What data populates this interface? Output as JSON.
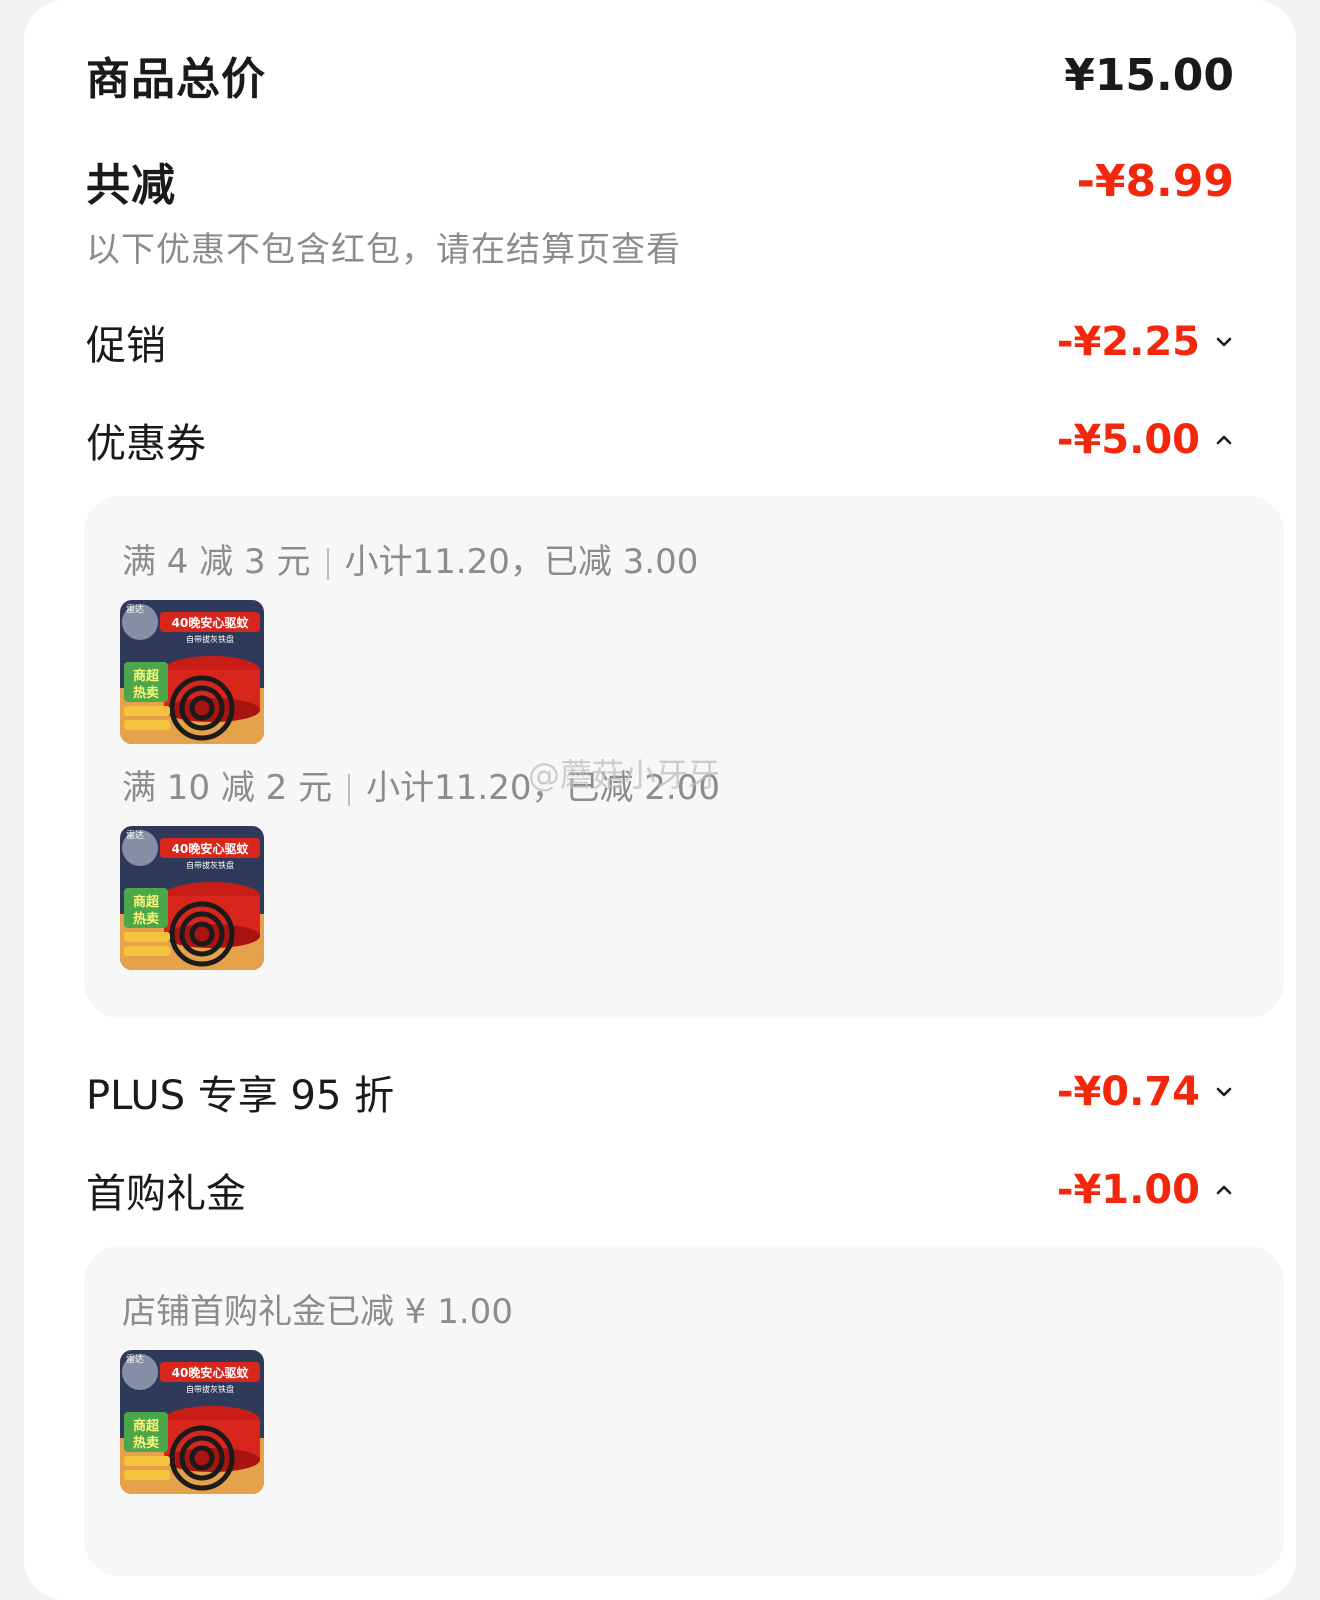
{
  "summary": {
    "total_label": "商品总价",
    "total_amount": "¥15.00",
    "reduce_label": "共减",
    "reduce_amount": "-¥8.99",
    "note": "以下优惠不包含红包，请在结算页查看"
  },
  "discounts": [
    {
      "label": "促销",
      "amount": "-¥2.25",
      "expanded": false
    },
    {
      "label": "优惠券",
      "amount": "-¥5.00",
      "expanded": true
    },
    {
      "label": "PLUS 专享 95 折",
      "amount": "-¥0.74",
      "expanded": false
    },
    {
      "label": "首购礼金",
      "amount": "-¥1.00",
      "expanded": true
    }
  ],
  "coupon_details": [
    {
      "rule": "满 4 减 3 元",
      "subtotal": "小计11.20，已减 3.00"
    },
    {
      "rule": "满 10 减 2 元",
      "subtotal": "小计11.20，已减 2.00"
    }
  ],
  "gift_detail": {
    "text": "店铺首购礼金已减 ¥ 1.00"
  },
  "product_image": {
    "brand": "雷达",
    "banner": "40晚安心驱蚊",
    "banner_sub": "自带拔灰铁盘",
    "badge": "商超热卖"
  },
  "watermark": "@蘑菇小牙牙",
  "colors": {
    "accent_red": "#f2270c",
    "text_dark": "#1a1a1a",
    "text_gray": "#8c8c8c",
    "panel_bg": "#f7f7f7"
  }
}
